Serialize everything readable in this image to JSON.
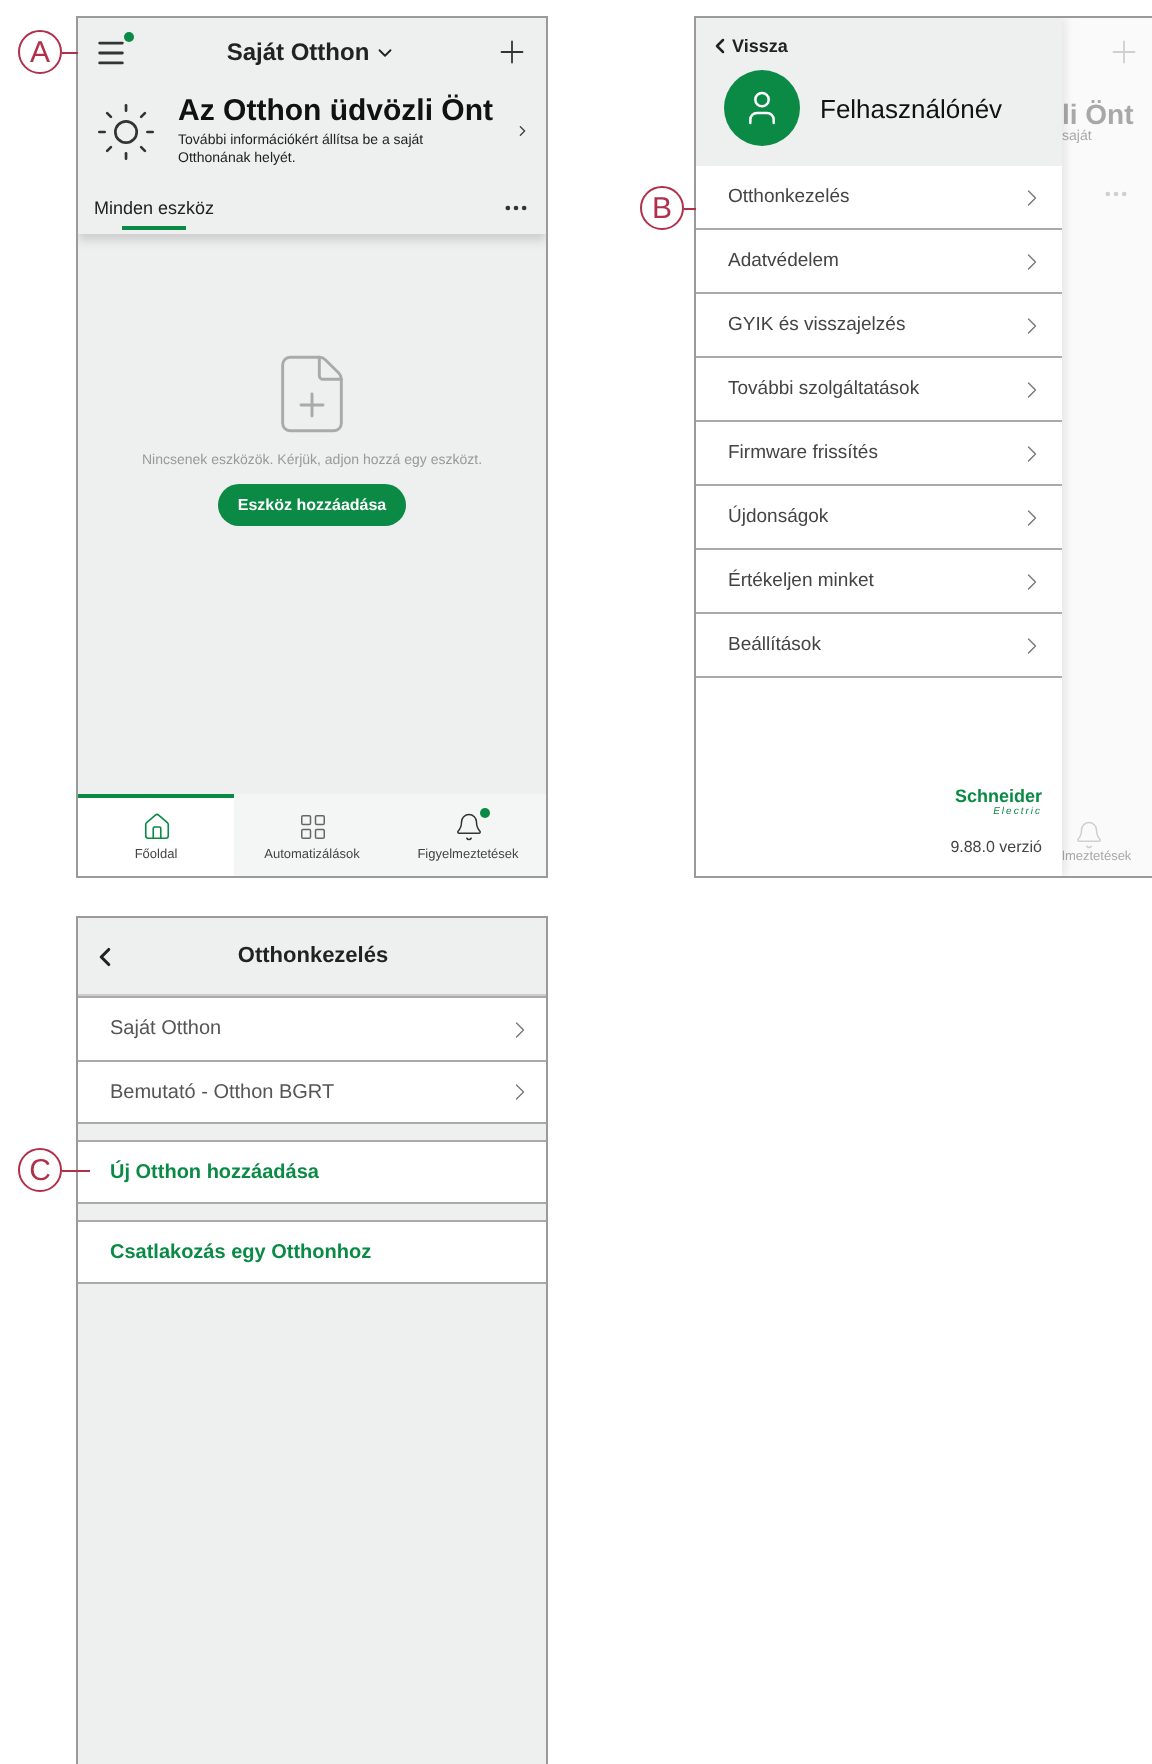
{
  "callouts": [
    {
      "label": "A"
    },
    {
      "label": "B"
    },
    {
      "label": "C"
    }
  ],
  "home_screen": {
    "title": "Saját Otthon",
    "welcome_title": "Az Otthon üdvözli Önt",
    "welcome_text": "További információkért állítsa be a saját Otthonának helyét.",
    "tabs": [
      {
        "label": "Minden eszköz",
        "selected": true
      }
    ],
    "empty_text": "Nincsenek eszközök. Kérjük, adjon hozzá egy eszközt.",
    "add_button": "Eszköz hozzáadása",
    "nav": [
      {
        "label": "Főoldal",
        "kind": "home",
        "selected": true
      },
      {
        "label": "Automatizálások",
        "kind": "grid",
        "selected": false
      },
      {
        "label": "Figyelmeztetések",
        "kind": "bell",
        "selected": false
      }
    ]
  },
  "menu_screen": {
    "back": "Vissza",
    "username": "Felhasználónév",
    "items": [
      "Otthonkezelés",
      "Adatvédelem",
      "GYIK és visszajelzés",
      "További szolgáltatások",
      "Firmware frissítés",
      "Újdonságok",
      "Értékeljen minket",
      "Beállítások"
    ],
    "brand": "Schneider",
    "brand_sub": "Electric",
    "version": "9.88.0 verzió",
    "behind": {
      "title_fragment": "li Önt",
      "text_fragment": "saját",
      "nav_fragment": "lmeztetések"
    }
  },
  "homes_screen": {
    "title": "Otthonkezelés",
    "homes": [
      "Saját Otthon",
      "Bemutató - Otthon BGRT"
    ],
    "actions": [
      "Új Otthon hozzáadása",
      "Csatlakozás egy Otthonhoz"
    ]
  }
}
